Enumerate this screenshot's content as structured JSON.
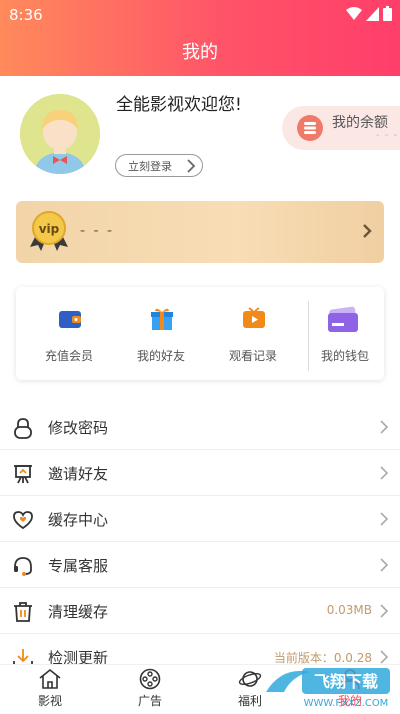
{
  "status": {
    "time": "8:36"
  },
  "header": {
    "title": "我的"
  },
  "profile": {
    "welcome": "全能影视欢迎您!",
    "login_label": "立刻登录"
  },
  "balance": {
    "label": "我的余额",
    "value": "- - -"
  },
  "vip": {
    "badge_text": "vip",
    "value": "- - -"
  },
  "grid": [
    {
      "label": "充值会员",
      "icon": "wallet-icon",
      "color": "#2f5fc4"
    },
    {
      "label": "我的好友",
      "icon": "gift-icon",
      "color": "#3aa0f0"
    },
    {
      "label": "观看记录",
      "icon": "play-icon",
      "color": "#f28a1a"
    },
    {
      "label": "我的钱包",
      "icon": "card-icon",
      "color": "#8e63e6"
    }
  ],
  "menu": [
    {
      "label": "修改密码",
      "icon": "lock-icon",
      "value": ""
    },
    {
      "label": "邀请好友",
      "icon": "easel-icon",
      "value": ""
    },
    {
      "label": "缓存中心",
      "icon": "heart-icon",
      "value": ""
    },
    {
      "label": "专属客服",
      "icon": "headset-icon",
      "value": ""
    },
    {
      "label": "清理缓存",
      "icon": "trash-icon",
      "value": "0.03MB"
    },
    {
      "label": "检测更新",
      "icon": "download-icon",
      "value": "当前版本：0.0.28"
    }
  ],
  "tabs": [
    {
      "label": "影视",
      "icon": "home-icon"
    },
    {
      "label": "广告",
      "icon": "film-reel-icon"
    },
    {
      "label": "福利",
      "icon": "planet-icon"
    },
    {
      "label": "我的",
      "icon": "user-icon"
    }
  ],
  "watermark": {
    "text": "飞翔下载",
    "url": "WWW.FXXZ.COM"
  },
  "colors": {
    "accent": "#ff4e5b",
    "header_start": "#ff8a5b",
    "header_end": "#ff3e6a",
    "vip_bg": "#f5d6ab"
  }
}
